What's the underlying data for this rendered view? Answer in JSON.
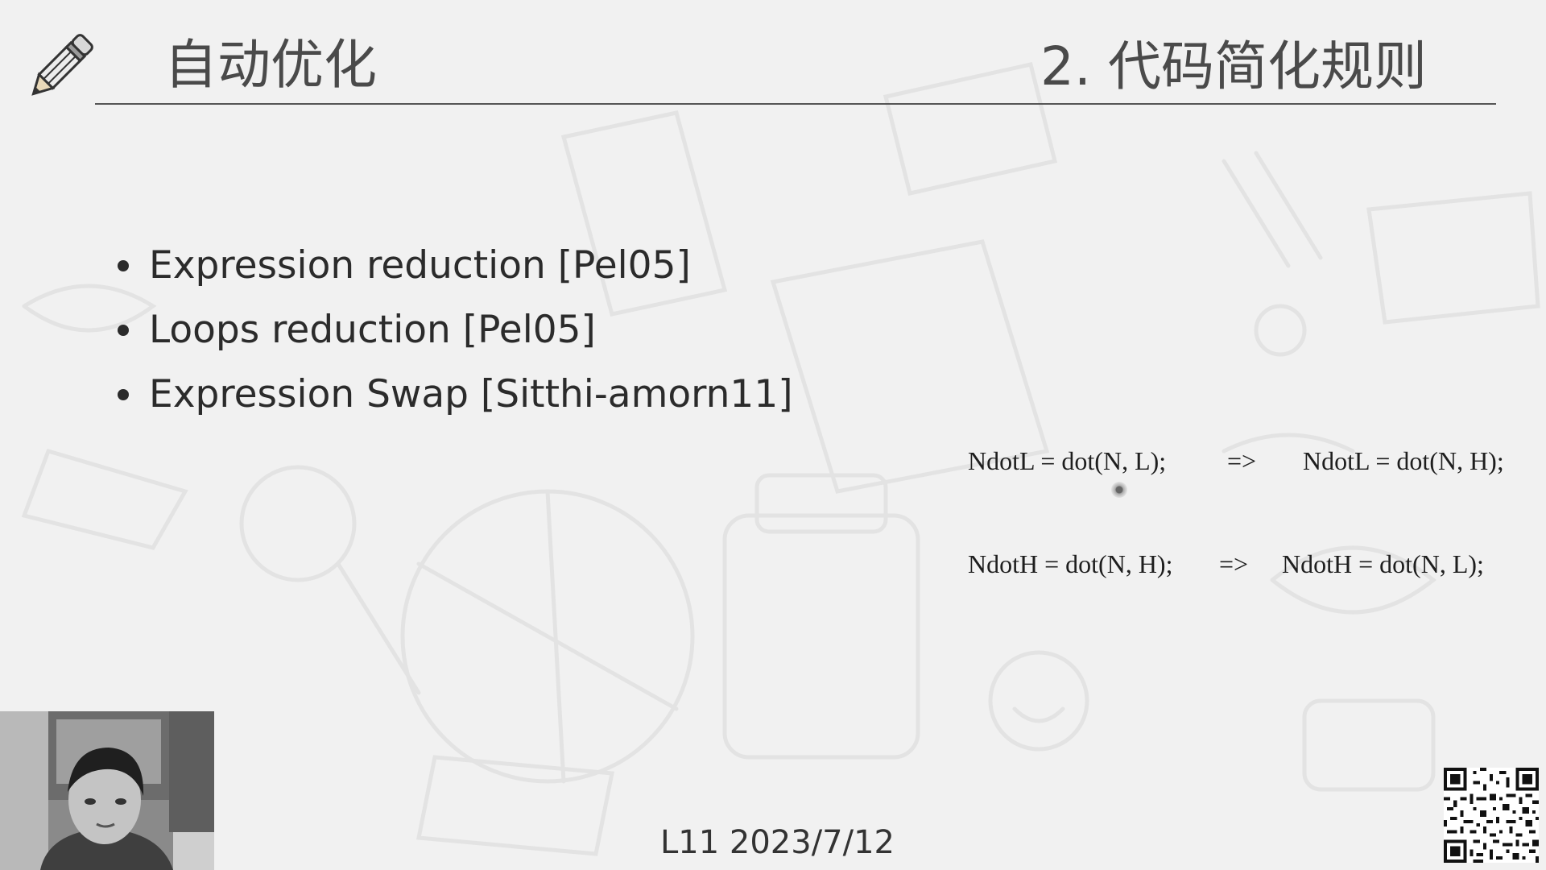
{
  "slide": {
    "section_title": "自动优化",
    "topic_title": "2. 代码简化规则",
    "bullets": [
      "Expression reduction [Pel05]",
      "Loops reduction [Pel05]",
      "Expression Swap [Sitthi-amorn11]"
    ],
    "code_swaps": [
      {
        "before": "NdotL = dot(N, L);",
        "arrow": "=>",
        "after": "NdotL = dot(N, H);"
      },
      {
        "before": "NdotH = dot(N, H);",
        "arrow": "=>",
        "after": "NdotH = dot(N, L);"
      }
    ],
    "footer": "L11 2023/7/12"
  },
  "icons": {
    "logo": "pencil-icon",
    "code": "qr-code",
    "presenter": "webcam-feed"
  }
}
